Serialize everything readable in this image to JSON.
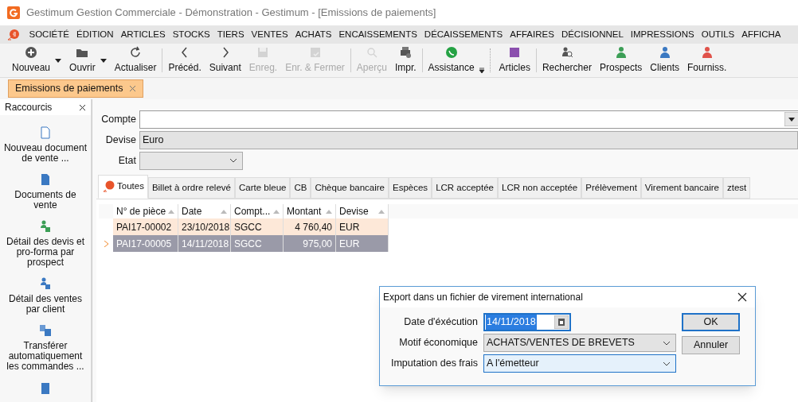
{
  "window": {
    "title": "Gestimum Gestion Commerciale - Démonstration - Gestimum - [Emissions de paiements]"
  },
  "menu": [
    "SOCIÉTÉ",
    "ÉDITION",
    "ARTICLES",
    "STOCKS",
    "TIERS",
    "VENTES",
    "ACHATS",
    "ENCAISSEMENTS",
    "DÉCAISSEMENTS",
    "AFFAIRES",
    "DÉCISIONNEL",
    "IMPRESSIONS",
    "OUTILS",
    "AFFICHA"
  ],
  "toolbar": [
    [
      {
        "label": "Nouveau",
        "disabled": false,
        "dropdown": true
      },
      {
        "label": "Ouvrir",
        "disabled": false,
        "dropdown": true
      },
      {
        "label": "Actualiser",
        "disabled": false,
        "dropdown": false
      }
    ],
    [
      {
        "label": "Précéd.",
        "disabled": false,
        "dropdown": false
      },
      {
        "label": "Suivant",
        "disabled": false,
        "dropdown": false
      },
      {
        "label": "Enreg.",
        "disabled": true,
        "dropdown": false
      },
      {
        "label": "Enr. & Fermer",
        "disabled": true,
        "dropdown": false
      }
    ],
    [
      {
        "label": "Aperçu",
        "disabled": true,
        "dropdown": false
      },
      {
        "label": "Impr.",
        "disabled": false,
        "dropdown": false
      }
    ],
    [
      {
        "label": "Assistance",
        "disabled": false,
        "dropdown": false
      }
    ],
    [
      {
        "label": "Articles",
        "disabled": false,
        "dropdown": false
      }
    ],
    [
      {
        "label": "Rechercher",
        "disabled": false,
        "dropdown": false
      },
      {
        "label": "Prospects",
        "disabled": false,
        "dropdown": false
      },
      {
        "label": "Clients",
        "disabled": false,
        "dropdown": false
      },
      {
        "label": "Fourniss.",
        "disabled": false,
        "dropdown": false
      }
    ]
  ],
  "document_tabs": [
    {
      "label": "Emissions de paiements",
      "selected": true
    }
  ],
  "sidebar": {
    "title": "Raccourcis",
    "items": [
      "Nouveau document de vente ...",
      "Documents de vente",
      "Détail des devis et pro-forma par prospect",
      "Détail des ventes par client",
      "Transférer automatiquement les commandes ..."
    ]
  },
  "form": {
    "compte": {
      "label": "Compte"
    },
    "devise": {
      "label": "Devise",
      "value": "Euro"
    },
    "etat": {
      "label": "Etat"
    }
  },
  "tabs": [
    {
      "label": "Toutes",
      "selected": true
    },
    {
      "label": "Billet à ordre relevé",
      "selected": false
    },
    {
      "label": "Carte bleue",
      "selected": false
    },
    {
      "label": "CB",
      "selected": false
    },
    {
      "label": "Chèque bancaire",
      "selected": false
    },
    {
      "label": "Espèces",
      "selected": false
    },
    {
      "label": "LCR acceptée",
      "selected": false
    },
    {
      "label": "LCR non acceptée",
      "selected": false
    },
    {
      "label": "Prélèvement",
      "selected": false
    },
    {
      "label": "Virement bancaire",
      "selected": false
    },
    {
      "label": "ztest",
      "selected": false
    }
  ],
  "table": {
    "columns": [
      "N° de pièce",
      "Date",
      "Compt...",
      "Montant",
      "Devise"
    ],
    "rows": [
      {
        "cells": [
          "PAI17-00002",
          "23/10/2018",
          "SGCC",
          "4 760,40",
          "EUR"
        ],
        "selected": false,
        "highlighted": true
      },
      {
        "cells": [
          "PAI17-00005",
          "14/11/2018",
          "SGCC",
          "975,00",
          "EUR"
        ],
        "selected": true,
        "highlighted": false
      }
    ]
  },
  "dialog": {
    "title": "Export dans un fichier de virement international",
    "fields": [
      {
        "label": "Date d'éxécution",
        "value": "14/11/2018",
        "kind": "date"
      },
      {
        "label": "Motif économique",
        "value": "ACHATS/VENTES DE BREVETS",
        "kind": "select"
      },
      {
        "label": "Imputation des frais",
        "value": "A l'émetteur",
        "kind": "select"
      }
    ],
    "buttons": [
      {
        "label": "OK",
        "default": true
      },
      {
        "label": "Annuler",
        "default": false
      }
    ]
  }
}
